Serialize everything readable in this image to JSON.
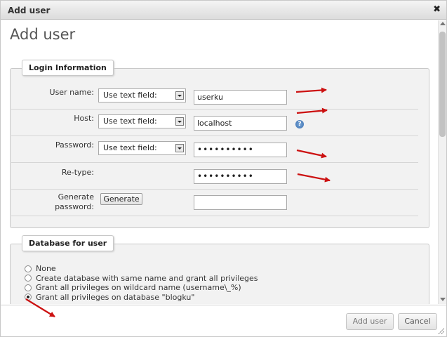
{
  "dialog": {
    "title": "Add user",
    "close_glyph": "✖"
  },
  "page": {
    "heading": "Add user"
  },
  "login": {
    "legend": "Login Information",
    "username": {
      "label": "User name:",
      "mode": "Use text field:",
      "value": "userku"
    },
    "host": {
      "label": "Host:",
      "mode": "Use text field:",
      "value": "localhost",
      "help_icon": "help-icon"
    },
    "password": {
      "label": "Password:",
      "mode": "Use text field:",
      "value": "••••••••••"
    },
    "retype": {
      "label": "Re-type:",
      "value": "••••••••••"
    },
    "generate": {
      "label_line1": "Generate",
      "label_line2": "password:",
      "button": "Generate",
      "value": ""
    }
  },
  "database": {
    "legend": "Database for user",
    "options": [
      {
        "label": "None",
        "checked": false
      },
      {
        "label": "Create database with same name and grant all privileges",
        "checked": false
      },
      {
        "label": "Grant all privileges on wildcard name (username\\_%)",
        "checked": false
      },
      {
        "label": "Grant all privileges on database \"blogku\"",
        "checked": true
      }
    ]
  },
  "footer": {
    "add_button": "Add user",
    "cancel_button": "Cancel"
  },
  "annotation_color": "#cc1111"
}
